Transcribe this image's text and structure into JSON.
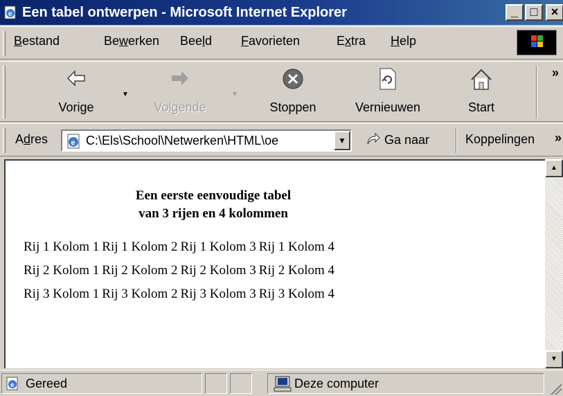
{
  "window": {
    "title": "Een tabel ontwerpen - Microsoft Internet Explorer",
    "minimize": "_",
    "maximize": "□",
    "close": "×"
  },
  "menu": [
    {
      "pre": "",
      "key": "B",
      "post": "estand"
    },
    {
      "pre": "Be",
      "key": "w",
      "post": "erken"
    },
    {
      "pre": "Bee",
      "key": "l",
      "post": "d"
    },
    {
      "pre": "",
      "key": "F",
      "post": "avorieten"
    },
    {
      "pre": "E",
      "key": "x",
      "post": "tra"
    },
    {
      "pre": "",
      "key": "H",
      "post": "elp"
    }
  ],
  "toolbar": {
    "back": "Vorige",
    "forward": "Volgende",
    "stop": "Stoppen",
    "refresh": "Vernieuwen",
    "home": "Start",
    "more": "»"
  },
  "address": {
    "label_pre": "A",
    "label_key": "d",
    "label_post": "res",
    "value": "C:\\Els\\School\\Netwerken\\HTML\\oe",
    "go": "Ga naar",
    "links": "Koppelingen",
    "links_more": "»"
  },
  "content": {
    "caption_line1": "Een eerste eenvoudige tabel",
    "caption_line2": "van 3 rijen en 4 kolommen",
    "rows": [
      [
        "Rij 1 Kolom 1",
        "Rij 1 Kolom 2",
        "Rij 1 Kolom 3",
        "Rij 1 Kolom 4"
      ],
      [
        "Rij 2 Kolom 1",
        "Rij 2 Kolom 2",
        "Rij 2 Kolom 3",
        "Rij 2 Kolom 4"
      ],
      [
        "Rij 3 Kolom 1",
        "Rij 3 Kolom 2",
        "Rij 3 Kolom 3",
        "Rij 3 Kolom 4"
      ]
    ]
  },
  "status": {
    "text": "Gereed",
    "zone": "Deze computer"
  },
  "colors": {
    "titlebar_start": "#0a246a",
    "titlebar_end": "#3a6ea5",
    "chrome": "#d4d0c8"
  },
  "icons": [
    "ie-page-icon",
    "back-arrow-icon",
    "forward-arrow-icon",
    "stop-icon",
    "refresh-icon",
    "home-icon",
    "go-arrow-icon",
    "computer-icon",
    "windows-logo-icon"
  ]
}
